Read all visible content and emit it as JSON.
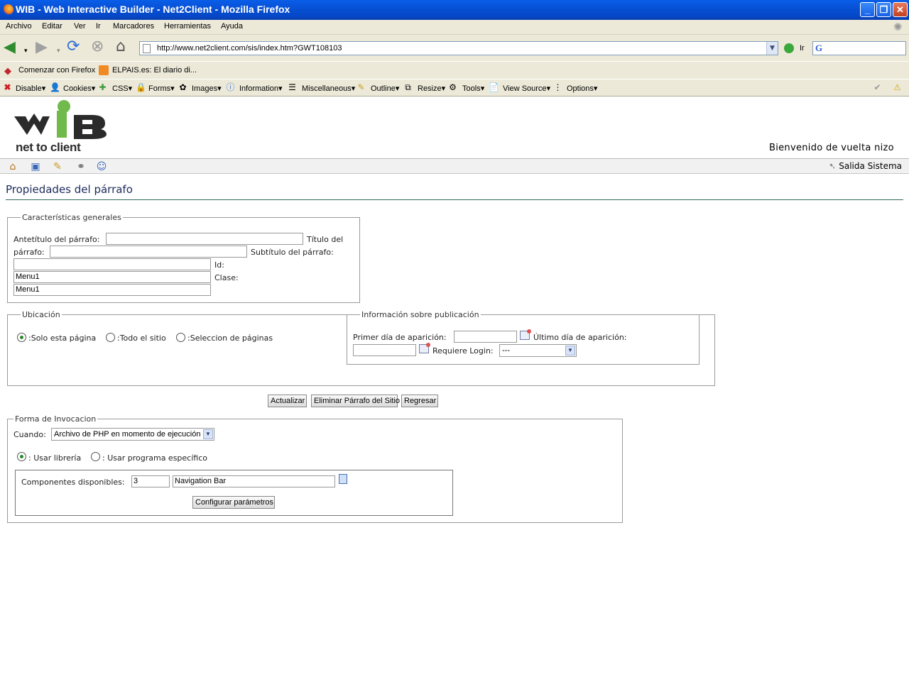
{
  "window": {
    "title": "WIB - Web Interactive Builder - Net2Client - Mozilla Firefox",
    "buttons": [
      "minimize",
      "maximize",
      "close"
    ]
  },
  "menu": [
    "Archivo",
    "Editar",
    "Ver",
    "Ir",
    "Marcadores",
    "Herramientas",
    "Ayuda"
  ],
  "nav": {
    "url": "http://www.net2client.com/sis/index.htm?GWT108103",
    "go_label": "Ir"
  },
  "bookmarks": [
    "Comenzar con Firefox",
    "ELPAIS.es: El diario di..."
  ],
  "devbar": [
    "Disable",
    "Cookies",
    "CSS",
    "Forms",
    "Images",
    "Information",
    "Miscellaneous",
    "Outline",
    "Resize",
    "Tools",
    "View Source",
    "Options"
  ],
  "logo": {
    "word": "net to client"
  },
  "header": {
    "welcome": "Bienvenido de vuelta nizo",
    "logout": "Salida Sistema"
  },
  "page": {
    "title": "Propiedades del párrafo"
  },
  "general": {
    "legend": "Características generales",
    "antetitulo_label": "Antetítulo del párrafo:",
    "titulo_label_1": "Título del",
    "titulo_label_2": "párrafo:",
    "subtitulo_label": "Subtítulo del párrafo:",
    "id_label": "Id:",
    "clase_label": "Clase:",
    "id_value": "Menu1",
    "clase_value": "Menu1"
  },
  "ubicacion": {
    "legend": "Ubicación",
    "options": [
      ":Solo esta página",
      ":Todo el sitio",
      ":Seleccion de páginas"
    ]
  },
  "publicacion": {
    "legend": "Información sobre publicación",
    "primer_dia_label": "Primer día de aparición:",
    "ultimo_dia_label": "Último día de aparición:",
    "requiere_login_label": "Requiere Login:",
    "requiere_login_value": "---"
  },
  "actions": [
    "Actualizar",
    "Eliminar Párrafo del Sitio",
    "Regresar"
  ],
  "invocacion": {
    "legend": "Forma de Invocacion",
    "cuando_label": "Cuando:",
    "cuando_value": "Archivo de PHP en momento de ejecución",
    "radio_libreria": ": Usar librería",
    "radio_programa": ": Usar programa específico",
    "componentes_label": "Componentes disponibles:",
    "componentes_id": "3",
    "componentes_name": "Navigation Bar",
    "configurar_label": "Configurar parámetros"
  }
}
